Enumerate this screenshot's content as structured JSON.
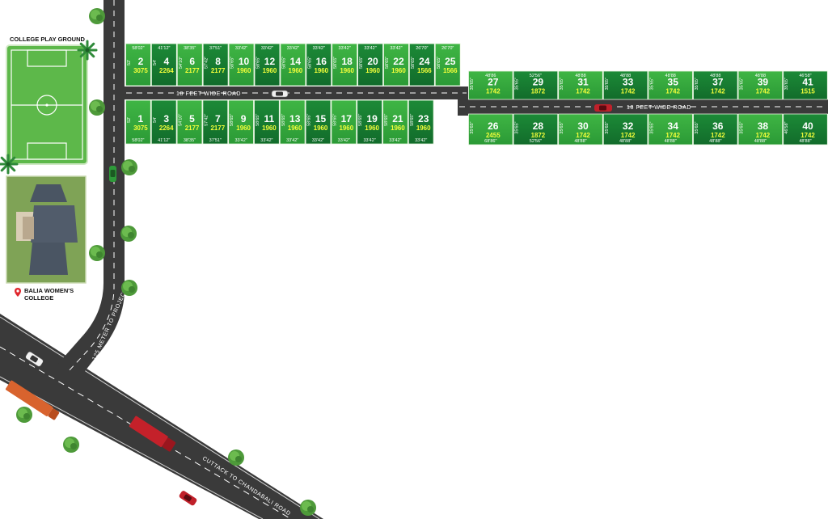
{
  "colors": {
    "plot_light": "#35a93b",
    "plot_dark": "#157a31",
    "plot_border": "#e8f5e0",
    "road": "#3a3a3a",
    "road_dash": "#ffffff",
    "area_text": "#f4ff3a",
    "field": "#5db84a",
    "tree": "#4e9a3a",
    "pin": "#e0262c"
  },
  "labels": {
    "play_ground": "COLLEGE PLAY GROUND",
    "college_line1": "BALIA WOMEN'S",
    "college_line2": "COLLEGE",
    "road_a": "18 FEET WIDE ROAD",
    "road_b": "18 FEET WIDE ROAD",
    "road_approach": "125 METER TO PROJECT",
    "main_road_1": "CUTTACK TO CHANDABALI ROAD",
    "main_road_2": "CUTTACK TO CHANDABALI ROAD"
  },
  "icons": {
    "pin": "location-pin-icon",
    "tree": "tree-icon",
    "palm": "palm-tree-icon",
    "car": "car-icon",
    "truck": "truck-icon"
  },
  "plots_upper_left": [
    {
      "no": "2",
      "area": "3075",
      "dim_top": "58'02\"",
      "dim_side": "52'"
    },
    {
      "no": "4",
      "area": "2264",
      "dim_top": "41'12\"",
      "dim_side": "54'"
    },
    {
      "no": "6",
      "area": "2177",
      "dim_top": "38'35\"",
      "dim_side": "54'10\""
    },
    {
      "no": "8",
      "area": "2177",
      "dim_top": "37'51\"",
      "dim_side": "57'42\""
    },
    {
      "no": "10",
      "area": "1960",
      "dim_top": "33'42\"",
      "dim_side": "58'65\""
    },
    {
      "no": "12",
      "area": "1960",
      "dim_top": "33'42\"",
      "dim_side": "58'65\""
    },
    {
      "no": "14",
      "area": "1960",
      "dim_top": "33'42\"",
      "dim_side": "58'65\""
    },
    {
      "no": "16",
      "area": "1960",
      "dim_top": "33'42\"",
      "dim_side": "58'65\""
    },
    {
      "no": "18",
      "area": "1960",
      "dim_top": "33'42\"",
      "dim_side": "58'65\""
    },
    {
      "no": "20",
      "area": "1960",
      "dim_top": "33'42\"",
      "dim_side": "58'65\""
    },
    {
      "no": "22",
      "area": "1960",
      "dim_top": "33'42\"",
      "dim_side": "58'65\""
    },
    {
      "no": "24",
      "area": "1566",
      "dim_top": "26'70\"",
      "dim_side": "58'65\""
    },
    {
      "no": "25",
      "area": "1566",
      "dim_top": "26'70\"",
      "dim_side": "58'65\""
    }
  ],
  "plots_lower_left": [
    {
      "no": "1",
      "area": "3075",
      "dim_bottom": "58'02\"",
      "dim_side": "52'"
    },
    {
      "no": "3",
      "area": "2264",
      "dim_bottom": "41'12\"",
      "dim_side": "54'"
    },
    {
      "no": "5",
      "area": "2177",
      "dim_bottom": "38'35\"",
      "dim_side": "54'10\""
    },
    {
      "no": "7",
      "area": "2177",
      "dim_bottom": "37'51\"",
      "dim_side": "57'42\""
    },
    {
      "no": "9",
      "area": "1960",
      "dim_bottom": "33'42\"",
      "dim_side": "58'65\""
    },
    {
      "no": "11",
      "area": "1960",
      "dim_bottom": "33'42\"",
      "dim_side": "58'65\""
    },
    {
      "no": "13",
      "area": "1960",
      "dim_bottom": "33'42\"",
      "dim_side": "58'65\""
    },
    {
      "no": "15",
      "area": "1960",
      "dim_bottom": "33'42\"",
      "dim_side": "58'65\""
    },
    {
      "no": "17",
      "area": "1960",
      "dim_bottom": "33'42\"",
      "dim_side": "58'65\""
    },
    {
      "no": "19",
      "area": "1960",
      "dim_bottom": "33'42\"",
      "dim_side": "58'65\""
    },
    {
      "no": "21",
      "area": "1960",
      "dim_bottom": "33'42\"",
      "dim_side": "58'65\""
    },
    {
      "no": "23",
      "area": "1960",
      "dim_bottom": "33'42\"",
      "dim_side": "58'65\""
    }
  ],
  "plots_upper_right": [
    {
      "no": "27",
      "area": "1742",
      "dim_top": "48'86",
      "dim_side": "35'65\""
    },
    {
      "no": "29",
      "area": "1872",
      "dim_top": "52'56\"",
      "dim_side": "35'65\""
    },
    {
      "no": "31",
      "area": "1742",
      "dim_top": "48'88",
      "dim_side": "35'65\""
    },
    {
      "no": "33",
      "area": "1742",
      "dim_top": "48'88",
      "dim_side": "35'65\""
    },
    {
      "no": "35",
      "area": "1742",
      "dim_top": "48'88",
      "dim_side": "35'65\""
    },
    {
      "no": "37",
      "area": "1742",
      "dim_top": "48'88",
      "dim_side": "35'65\""
    },
    {
      "no": "39",
      "area": "1742",
      "dim_top": "48'88",
      "dim_side": "35'65\""
    },
    {
      "no": "41",
      "area": "1515",
      "dim_top": "46'58\"",
      "dim_side": "35'65\""
    }
  ],
  "plots_lower_right": [
    {
      "no": "26",
      "area": "2455",
      "dim_bottom": "68'86\"",
      "dim_side": "35'65\""
    },
    {
      "no": "28",
      "area": "1872",
      "dim_bottom": "52'56\"",
      "dim_side": "35'65\""
    },
    {
      "no": "30",
      "area": "1742",
      "dim_bottom": "48'88\"",
      "dim_side": "35'65\""
    },
    {
      "no": "32",
      "area": "1742",
      "dim_bottom": "48'88\"",
      "dim_side": "35'65\""
    },
    {
      "no": "34",
      "area": "1742",
      "dim_bottom": "48'88\"",
      "dim_side": "35'65\""
    },
    {
      "no": "36",
      "area": "1742",
      "dim_bottom": "48'88\"",
      "dim_side": "35'65\""
    },
    {
      "no": "38",
      "area": "1742",
      "dim_bottom": "48'88\"",
      "dim_side": "35'65\""
    },
    {
      "no": "40",
      "area": "1742",
      "dim_bottom": "48'88\"",
      "dim_side": "46'58\""
    }
  ]
}
